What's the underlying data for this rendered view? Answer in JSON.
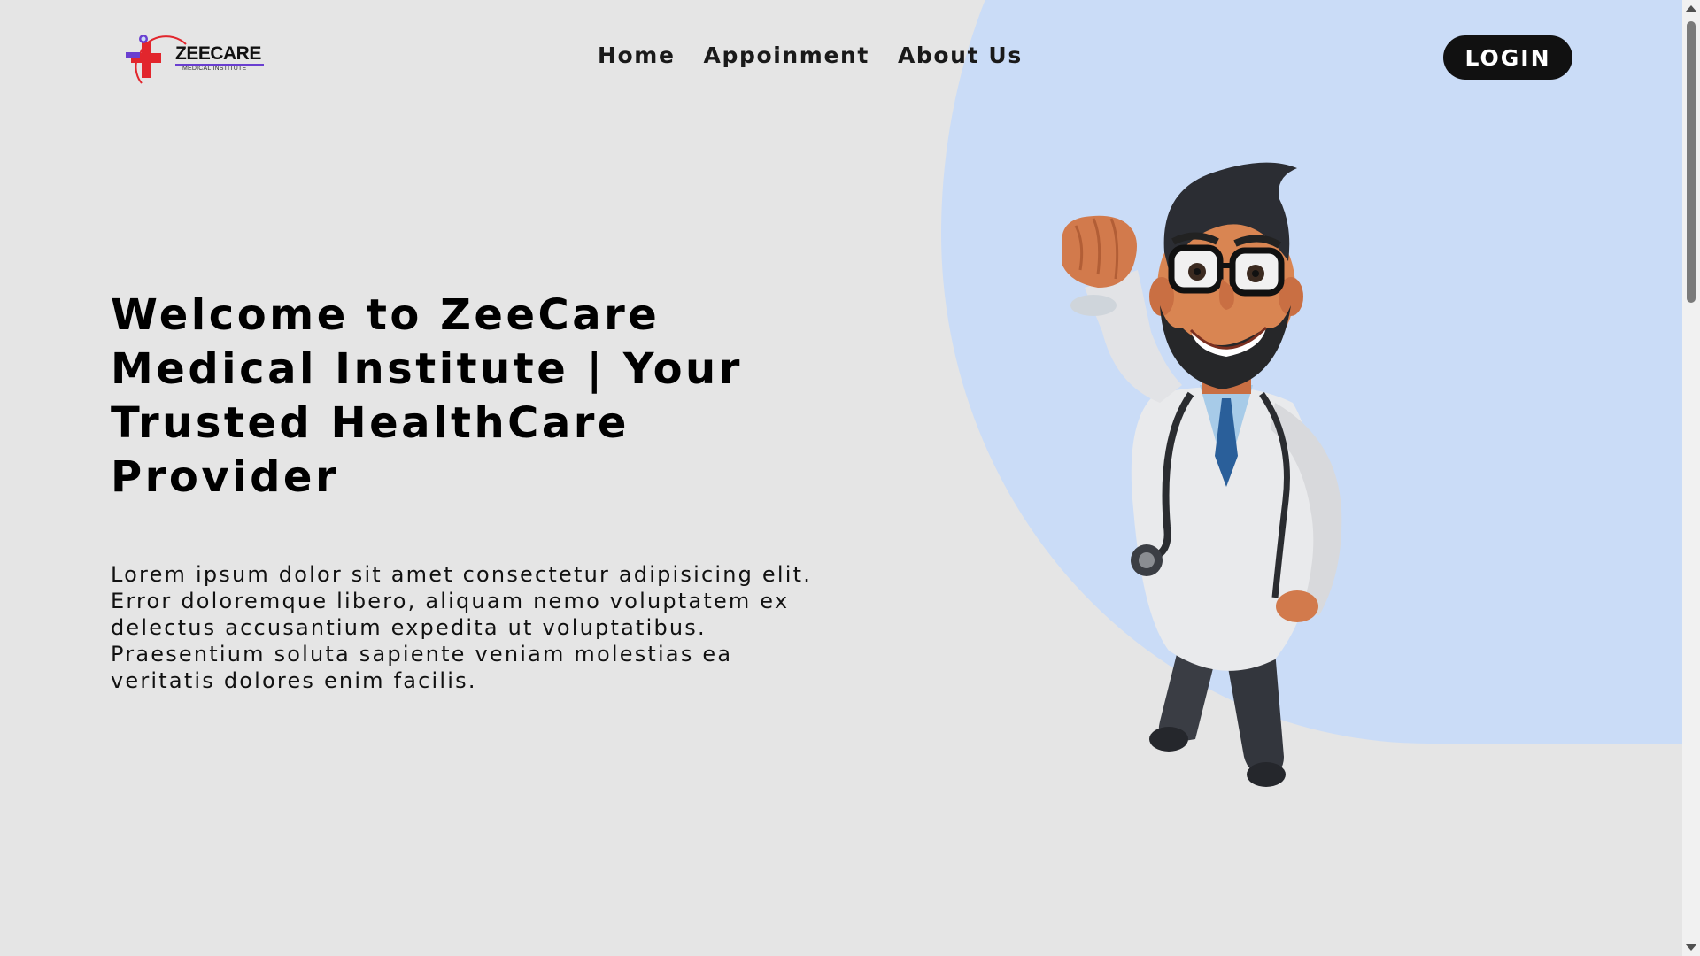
{
  "brand": {
    "name": "ZEECARE",
    "tagline": "MEDICAL INSTITUTE"
  },
  "nav": {
    "links": [
      "Home",
      "Appoinment",
      "About Us"
    ],
    "login_label": "LOGIN"
  },
  "hero": {
    "title": "Welcome to ZeeCare Medical Institute | Your Trusted HealthCare Provider",
    "description": "Lorem ipsum dolor sit amet consectetur adipisicing elit. Error doloremque libero, aliquam nemo voluptatem ex delectus accusantium expedita ut voluptatibus. Praesentium soluta sapiente veniam molestias ea veritatis dolores enim facilis."
  },
  "illustration": {
    "icon": "doctor-superhero-illustration"
  },
  "colors": {
    "background": "#e5e5e5",
    "accent_blob": "#cadcf7",
    "login_button": "#111111",
    "logo_red": "#e2262d",
    "logo_purple": "#6a3fd0"
  }
}
